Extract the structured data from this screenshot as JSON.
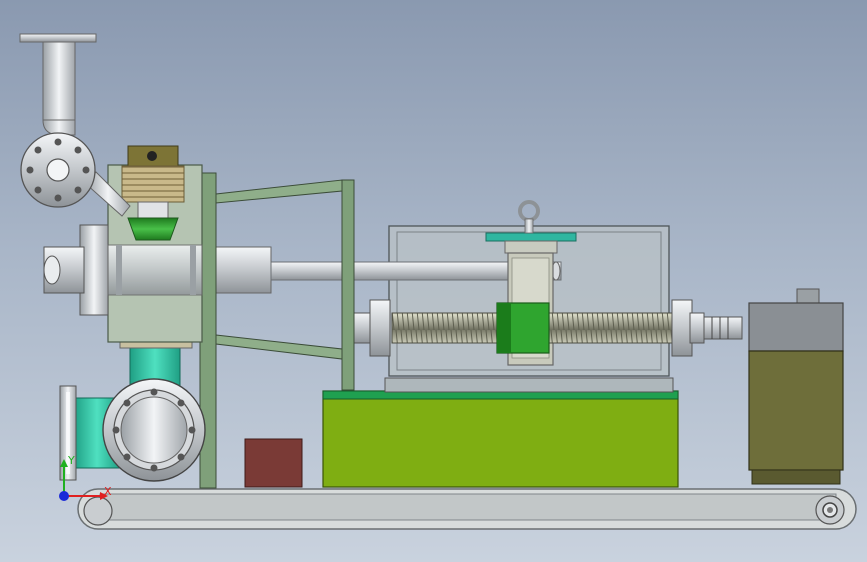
{
  "viewport": {
    "background_top": "#8a99b0",
    "background_bottom": "#c9d2de"
  },
  "triad": {
    "x_label": "X",
    "y_label": "Y",
    "x_color": "#e02020",
    "y_color": "#20b020",
    "z_color": "#1a2ad8"
  },
  "colors": {
    "frame_green": "#7fa07a",
    "base_lime": "#7fae12",
    "teal": "#2fc0a0",
    "steel": "#b9bdc2",
    "motor_olive": "#6e6e3a",
    "brown_box": "#7a3a36",
    "housing_glass": "#b9c2c6"
  },
  "parts": [
    "inlet-flange",
    "inlet-pipe",
    "bellows",
    "main-pipe-body",
    "shaft",
    "frame",
    "support-arms",
    "pump-flange",
    "teal-elbow",
    "brown-box",
    "base-block",
    "housing",
    "lifting-eye",
    "lead-screw",
    "slider-block",
    "motor",
    "conveyor-belt"
  ]
}
